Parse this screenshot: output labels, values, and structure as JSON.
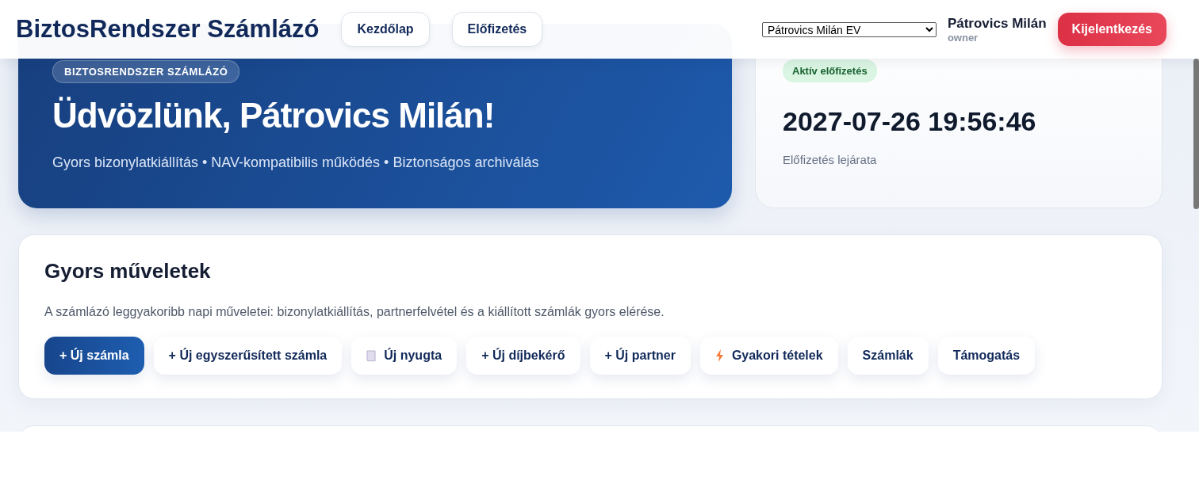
{
  "header": {
    "brand": "BiztosRendszer Számlázó",
    "nav": [
      {
        "label": "Kezdőlap"
      },
      {
        "label": "Előfizetés"
      }
    ],
    "company_select": {
      "value": "Pátrovics Milán EV"
    },
    "user": {
      "name": "Pátrovics Milán",
      "role": "owner"
    },
    "logout": "Kijelentkezés"
  },
  "hero": {
    "badge": "BIZTOSRENDSZER SZÁMLÁZÓ",
    "title": "Üdvözlünk, Pátrovics Milán!",
    "subtitle": "Gyors bizonylatkiállítás • NAV-kompatibilis működés • Biztonságos archiválás"
  },
  "subscription": {
    "status": "Aktív előfizetés",
    "expiry": "2027-07-26 19:56:46",
    "label": "Előfizetés lejárata"
  },
  "quick_actions": {
    "title": "Gyors műveletek",
    "description": "A számlázó leggyakoribb napi műveletei: bizonylatkiállítás, partnerfelvétel és a kiállított számlák gyors elérése.",
    "buttons": [
      {
        "label": "+ Új számla",
        "kind": "primary"
      },
      {
        "label": "+ Új egyszerűsített számla",
        "kind": "plain"
      },
      {
        "label": "Új nyugta",
        "kind": "receipt"
      },
      {
        "label": "+ Új díjbekérő",
        "kind": "plain"
      },
      {
        "label": "+ Új partner",
        "kind": "plain"
      },
      {
        "label": "Gyakori tételek",
        "kind": "bolt"
      },
      {
        "label": "Számlák",
        "kind": "plain"
      },
      {
        "label": "Támogatás",
        "kind": "plain"
      }
    ]
  }
}
